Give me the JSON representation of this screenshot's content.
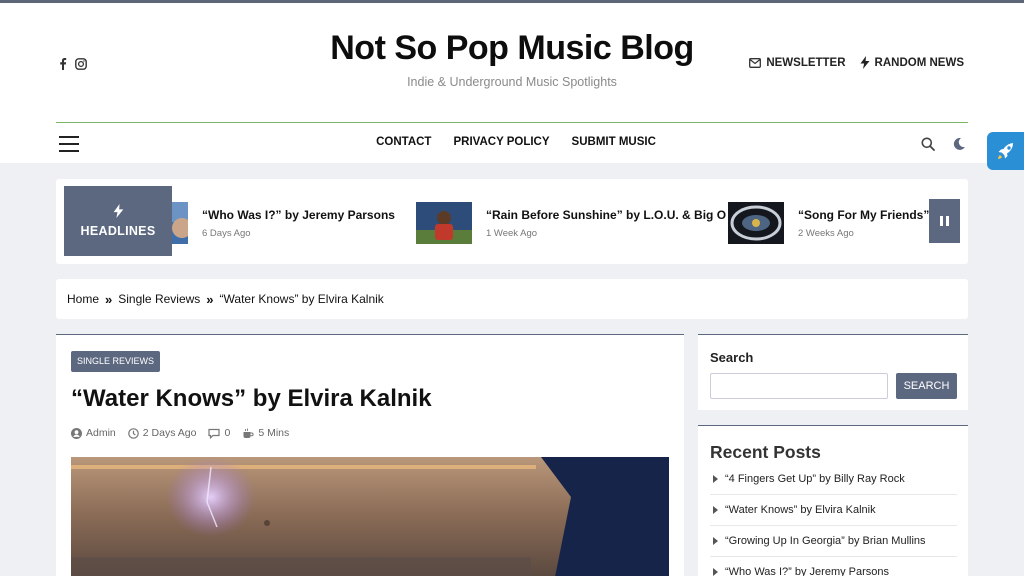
{
  "site": {
    "title": "Not So Pop Music Blog",
    "tagline": "Indie & Underground Music Spotlights"
  },
  "social": {
    "icons": [
      "facebook-icon",
      "instagram-icon"
    ]
  },
  "header_links": [
    {
      "label": "NEWSLETTER",
      "icon": "envelope-icon"
    },
    {
      "label": "RANDOM NEWS",
      "icon": "bolt-icon"
    }
  ],
  "nav": {
    "items": [
      "CONTACT",
      "PRIVACY POLICY",
      "SUBMIT MUSIC"
    ]
  },
  "ticker": {
    "label": "HEADLINES",
    "items": [
      {
        "title": "“Who Was I?” by Jeremy Parsons",
        "date": "6 Days Ago"
      },
      {
        "title": "“Rain Before Sunshine” by L.O.U. & Big O",
        "date": "1 Week Ago"
      },
      {
        "title": "“Song For My Friends” b",
        "date": "2 Weeks Ago"
      }
    ]
  },
  "breadcrumb": [
    "Home",
    "Single Reviews",
    "“Water Knows” by Elvira Kalnik"
  ],
  "post": {
    "category": "SINGLE REVIEWS",
    "title": "“Water Knows” by Elvira Kalnik",
    "author": "Admin",
    "date": "2 Days Ago",
    "comments": "0",
    "read_time": "5 Mins"
  },
  "sidebar": {
    "search": {
      "title": "Search",
      "button": "SEARCH",
      "value": ""
    },
    "recent": {
      "title": "Recent Posts",
      "items": [
        "“4 Fingers Get Up” by Billy Ray Rock",
        "“Water Knows” by Elvira Kalnik",
        "“Growing Up In Georgia” by Brian Mullins",
        "“Who Was I?” by Jeremy Parsons"
      ]
    }
  },
  "colors": {
    "accent": "#5c6880",
    "nav_rule": "#7cb46a",
    "rocket": "#2b8fd6",
    "background": "#eef0f4"
  }
}
